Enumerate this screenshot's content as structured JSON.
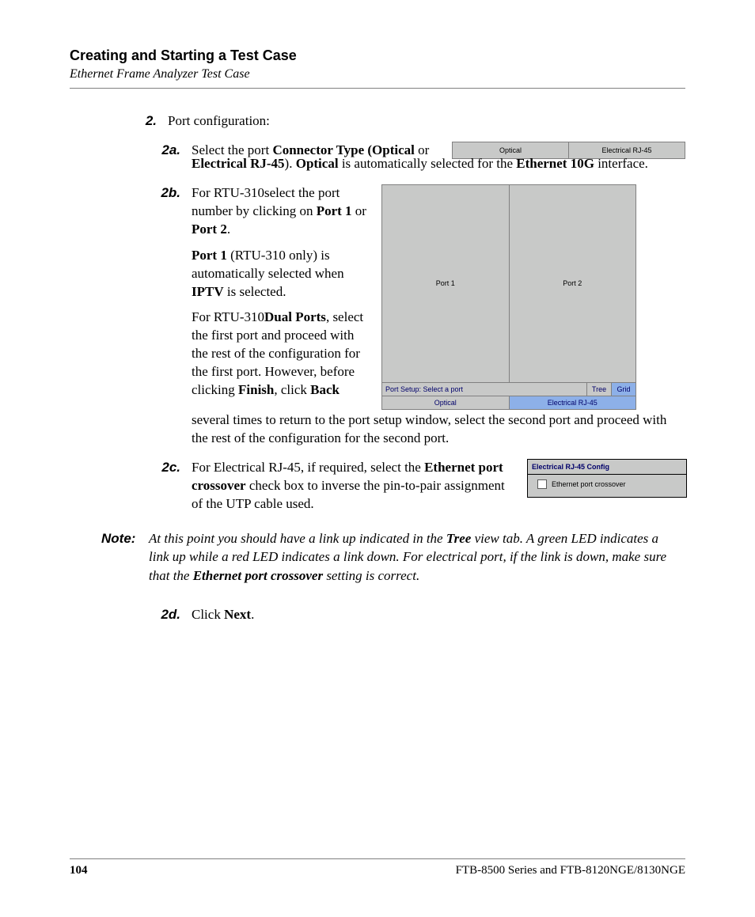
{
  "header": {
    "title": "Creating and Starting a Test Case",
    "subtitle": "Ethernet Frame Analyzer Test Case"
  },
  "step2": {
    "num": "2.",
    "text": "Port configuration:"
  },
  "s2a": {
    "num": "2a.",
    "line1_pre": "Select the port ",
    "b1": "Connector Type (Optical",
    "line1_mid": " or ",
    "b2": "Electrical RJ-45",
    "line1_post": "). ",
    "b3": "Optical",
    "line2_mid": " is automatically selected for the ",
    "b4": "Ethernet 10G",
    "line2_end": " interface."
  },
  "fig2a": {
    "optical": "Optical",
    "rj45": "Electrical RJ-45"
  },
  "s2b": {
    "num": "2b.",
    "p1_pre": "For RTU-310select the port number by clicking on ",
    "p1_b1": "Port 1",
    "p1_or": " or ",
    "p1_b2": "Port 2",
    "p1_end": ".",
    "p2_b1": "Port 1",
    "p2_mid": " (RTU-310 only) is automatically selected when ",
    "p2_b2": "IPTV",
    "p2_end": " is selected.",
    "p3_pre": "For RTU-310",
    "p3_b1": "Dual Ports",
    "p3_mid": ", select the first port and proceed with the rest of the configuration for the first port. However, before clicking ",
    "p3_b2": "Finish",
    "p3_mid2": ", click ",
    "p3_b3": "Back",
    "p3_cont": " several times to return to the port setup window, select the second port and proceed with the rest of the configuration for the second port."
  },
  "fig2b": {
    "port1": "Port 1",
    "port2": "Port 2",
    "status": "Port Setup: Select a port",
    "tree": "Tree",
    "grid": "Grid",
    "optical": "Optical",
    "rj45": "Electrical RJ-45"
  },
  "s2c": {
    "num": "2c.",
    "pre": "For Electrical RJ-45, if required, select the ",
    "b1": "Ethernet port crossover",
    "post": " check box to inverse the pin-to-pair assignment of the UTP cable used."
  },
  "fig2c": {
    "title": "Electrical RJ-45 Config",
    "cb": "Ethernet port crossover"
  },
  "note": {
    "label": "Note:",
    "t1": "At this point you should have a link up indicated in the ",
    "b1": "Tree",
    "t2": " view tab. A green LED indicates a link up while a red LED indicates a link down. For electrical port, if the link is down, make sure that the ",
    "b2": "Ethernet port crossover",
    "t3": " setting is correct."
  },
  "s2d": {
    "num": "2d.",
    "pre": "Click ",
    "b1": "Next",
    "post": "."
  },
  "footer": {
    "page": "104",
    "doc": "FTB-8500 Series and FTB-8120NGE/8130NGE"
  }
}
